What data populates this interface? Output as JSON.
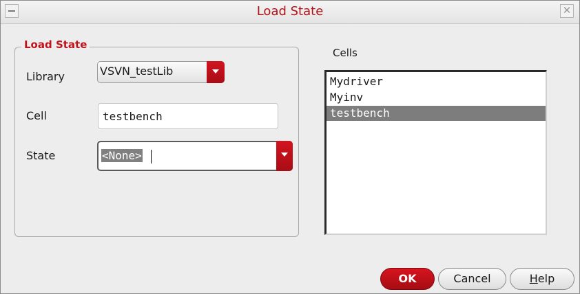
{
  "window": {
    "title": "Load State",
    "accent_color": "#c0121a"
  },
  "group": {
    "title": "Load State",
    "library_label": "Library",
    "library_value": "VSVN_testLib",
    "cell_label": "Cell",
    "cell_value": "testbench",
    "state_label": "State",
    "state_value": "<None>"
  },
  "cells": {
    "label": "Cells",
    "items": [
      {
        "label": "Mydriver",
        "selected": false
      },
      {
        "label": "Myinv",
        "selected": false
      },
      {
        "label": "testbench",
        "selected": true
      }
    ]
  },
  "buttons": {
    "ok_label": "OK",
    "cancel_label": "Cancel",
    "help_label": "Help"
  },
  "icons": {
    "window_menu": "window-menu-icon",
    "close": "close-icon",
    "dropdown": "chevron-down-icon"
  }
}
